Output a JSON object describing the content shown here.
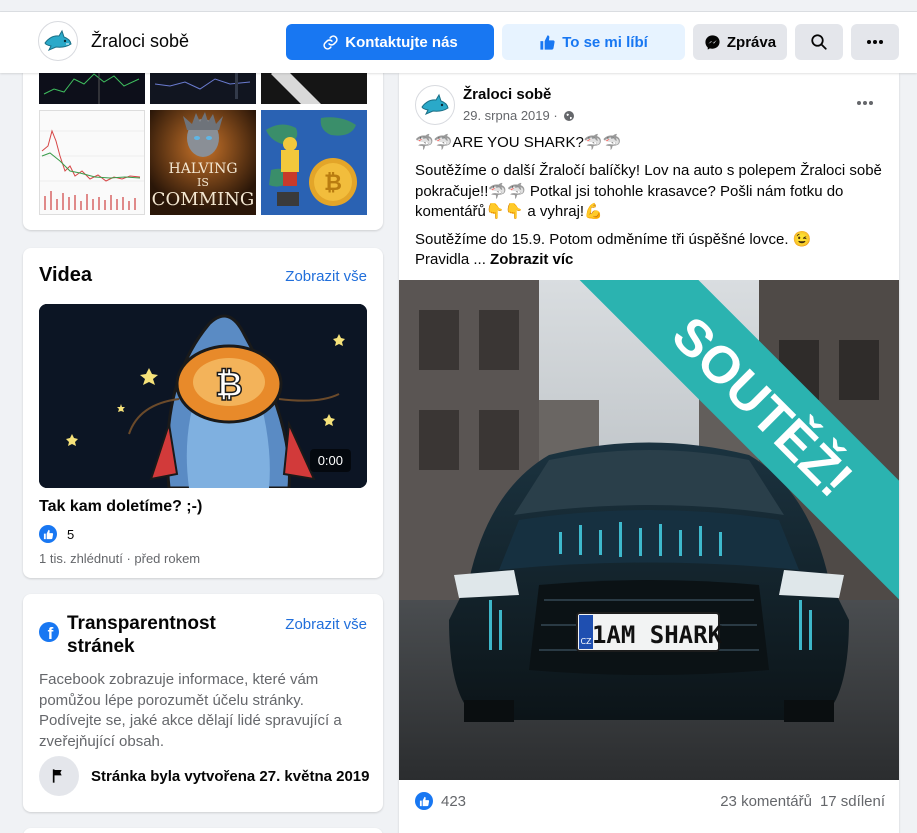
{
  "page": {
    "name": "Žraloci sobě"
  },
  "header": {
    "contact_button": "Kontaktujte nás",
    "like_button": "To se mi líbí",
    "message_button": "Zpráva"
  },
  "photos": {
    "halving_line1": "HALVING",
    "halving_line2": "IS",
    "halving_line3": "COMMING"
  },
  "videos": {
    "title": "Videa",
    "see_all": "Zobrazit vše",
    "item": {
      "duration": "0:00",
      "title": "Tak kam doletíme? ;-)",
      "likes": "5",
      "meta": "1 tis. zhlédnutí · před rokem"
    }
  },
  "transparency": {
    "title": "Transparentnost stránek",
    "see_all": "Zobrazit vše",
    "description": "Facebook zobrazuje informace, které vám pomůžou lépe porozumět účelu stránky. Podívejte se, jaké akce dělají lidé spravující a zveřejňující obsah.",
    "created": "Stránka byla vytvořena 27. května 2019"
  },
  "post": {
    "author": "Žraloci sobě",
    "date": "29. srpna 2019 ·",
    "line1": "🦈🦈ARE YOU SHARK?🦈🦈",
    "paragraph1": "Soutěžíme o další Žraločí balíčky! Lov na auto s polepem Žraloci sobě pokračuje!!🦈🦈 Potkal jsi tohohle krasavce? Pošli nám fotku do komentářů👇👇 a vyhraj!💪",
    "paragraph2": "Soutěžíme do 15.9. Potom odměníme tři úspěšné lovce. 😉",
    "paragraph3_start": "Pravidla ...",
    "see_more": "Zobrazit víc",
    "banner": "SOUTĚŽ!",
    "plate": "1AM SHARK",
    "plate_country": "CZ",
    "likes": "423",
    "comments": "23 komentářů",
    "shares": "17 sdílení"
  },
  "colors": {
    "primary": "#1877f2",
    "banner": "#2bb3b0",
    "link": "#216fdb"
  }
}
